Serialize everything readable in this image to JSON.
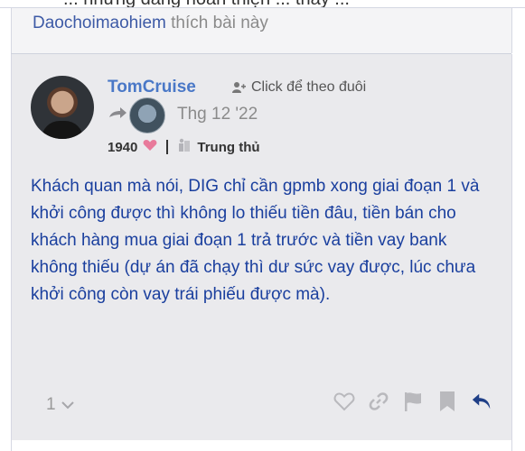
{
  "top_clipped": {
    "text": "... nhưng đang hoàn thiện ... thấy ..."
  },
  "liked_by": {
    "user": "Daochoimaohiem",
    "suffix": "thích bài này"
  },
  "post": {
    "username": "TomCruise",
    "follow_label": "Click để theo đuôi",
    "date": "Thg 12 '22",
    "likes_count": "1940",
    "badge": "Trung thủ",
    "body": "Khách quan mà nói, DIG chỉ cần gpmb xong giai đoạn 1 và khởi công được thì không lo thiếu tiền đâu, tiền bán cho khách hàng mua giai đoạn 1 trả trước và tiền vay bank không thiếu (dự án đã chạy thì dư sức vay được, lúc chưa khởi công còn vay trái phiếu được mà).",
    "reply_count": "1"
  },
  "colors": {
    "username": "#4a78c7",
    "body_text": "#1a3f9e",
    "heart": "#e87a9b",
    "reply_arrow": "#1f3f87",
    "icon_gray": "#b9b9bd"
  },
  "icons": [
    "add-user-icon",
    "reply-arrow-icon",
    "heart-icon",
    "badge-icon",
    "chevron-down-icon",
    "link-icon",
    "flag-icon",
    "bookmark-icon",
    "reply-icon"
  ]
}
